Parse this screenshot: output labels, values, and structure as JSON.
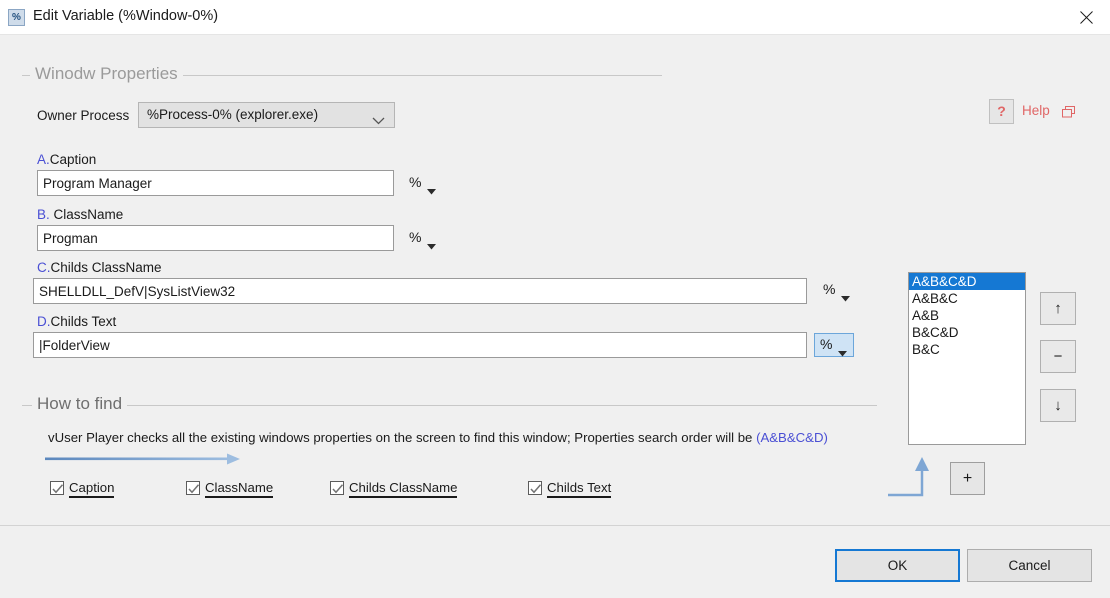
{
  "window": {
    "title": "Edit Variable (%Window-0%)",
    "icon": "percent-icon",
    "close_icon": "close-icon"
  },
  "groups": {
    "window_properties": {
      "title": "Winodw Properties"
    },
    "how_to_find": {
      "title": "How to find"
    }
  },
  "owner_process": {
    "label": "Owner Process",
    "value": "%Process-0% (explorer.exe)",
    "chevron_icon": "chevron-down-icon"
  },
  "help": {
    "icon": "question-mark-icon",
    "label": "Help",
    "external_icon": "window-icon",
    "color": "#e06666"
  },
  "fields": [
    {
      "letter": "A.",
      "name": "Caption",
      "value": "Program Manager",
      "pct_label": "%",
      "pct_caret": "caret-down-icon",
      "highlighted": false
    },
    {
      "letter": "B.",
      "name": "ClassName",
      "value": "Progman",
      "pct_label": "%",
      "pct_caret": "caret-down-icon",
      "highlighted": false
    },
    {
      "letter": "C.",
      "name": "Childs ClassName",
      "value": "SHELLDLL_DefV|SysListView32",
      "pct_label": "%",
      "pct_caret": "caret-down-icon",
      "highlighted": false
    },
    {
      "letter": "D.",
      "name": "Childs Text",
      "value": "|FolderView",
      "pct_label": "%",
      "pct_caret": "caret-down-icon",
      "highlighted": true
    }
  ],
  "listbox": {
    "items": [
      {
        "label": "A&B&C&D",
        "selected": true
      },
      {
        "label": "A&B&C",
        "selected": false
      },
      {
        "label": "A&B",
        "selected": false
      },
      {
        "label": "B&C&D",
        "selected": false
      },
      {
        "label": "B&C",
        "selected": false
      }
    ],
    "selected_color": "#1578d3"
  },
  "side_buttons": {
    "move_up": "↑",
    "remove": "−",
    "move_down": "↓",
    "add": "+"
  },
  "how_to_find": {
    "description": "vUser Player checks all the existing windows properties on the screen to find this window; Properties search order will be ",
    "search_order": "(A&B&C&D)",
    "order_color": "#4a4fd4",
    "arrow_icon": "right-arrow-icon",
    "add_arrow_icon": "up-arrow-elbow-icon",
    "checkboxes": [
      {
        "label": "Caption",
        "checked": true
      },
      {
        "label": "ClassName",
        "checked": true
      },
      {
        "label": "Childs ClassName",
        "checked": true
      },
      {
        "label": "Childs Text",
        "checked": true
      }
    ]
  },
  "footer": {
    "ok_label": "OK",
    "cancel_label": "Cancel",
    "focus_color": "#1578d3"
  }
}
